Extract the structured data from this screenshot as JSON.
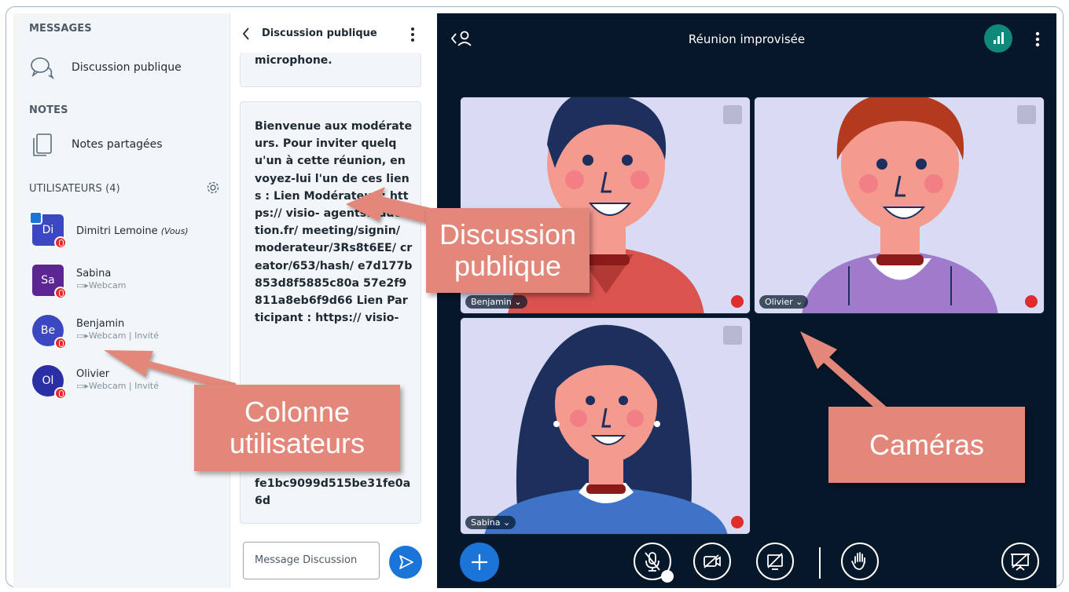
{
  "sidebar": {
    "messages_heading": "MESSAGES",
    "public_chat_label": "Discussion publique",
    "notes_heading": "NOTES",
    "shared_notes_label": "Notes partagées",
    "users_heading": "UTILISATEURS (4)",
    "users": [
      {
        "initials": "Di",
        "name": "Dimitri Lemoine",
        "you": "(Vous)",
        "sub": "",
        "color": "#3b48c2"
      },
      {
        "initials": "Sa",
        "name": "Sabina",
        "you": "",
        "sub": "Webcam",
        "color": "#5b2594"
      },
      {
        "initials": "Be",
        "name": "Benjamin",
        "you": "",
        "sub": "Webcam | Invité",
        "color": "#3b48c2"
      },
      {
        "initials": "Ol",
        "name": "Olivier",
        "you": "",
        "sub": "Webcam | Invité",
        "color": "#2a2fa6"
      }
    ]
  },
  "chat": {
    "title": "Discussion publique",
    "prev_message_fragment": "microphone.",
    "welcome_message": "Bienvenue aux modérateurs. Pour inviter quelqu'un à cette réunion, envoyez-lui l'un de ces liens : Lien Modérateur : https:// visio- agents.education.fr/ meeting/signin/ moderateur/3Rs8t6EE/ creator/653/hash/ e7d177b853d8f5885c80a 57e2f9811a8eb6f9d66 Lien Participant : https:// visio-",
    "message_tail": "fe1bc9099d515be31fe0a6d",
    "input_placeholder": "Message Discussion"
  },
  "meeting": {
    "title": "Réunion improvisée",
    "tiles": [
      {
        "name": "Benjamin"
      },
      {
        "name": "Olivier"
      },
      {
        "name": "Sabina"
      }
    ]
  },
  "callouts": {
    "chat": "Discussion\npublique",
    "users": "Colonne\nutilisateurs",
    "cameras": "Caméras"
  },
  "colors": {
    "meeting_bg": "#06172a",
    "accent": "#1b75d9",
    "callout": "#e2877a",
    "mute_red": "#e02c2c"
  }
}
